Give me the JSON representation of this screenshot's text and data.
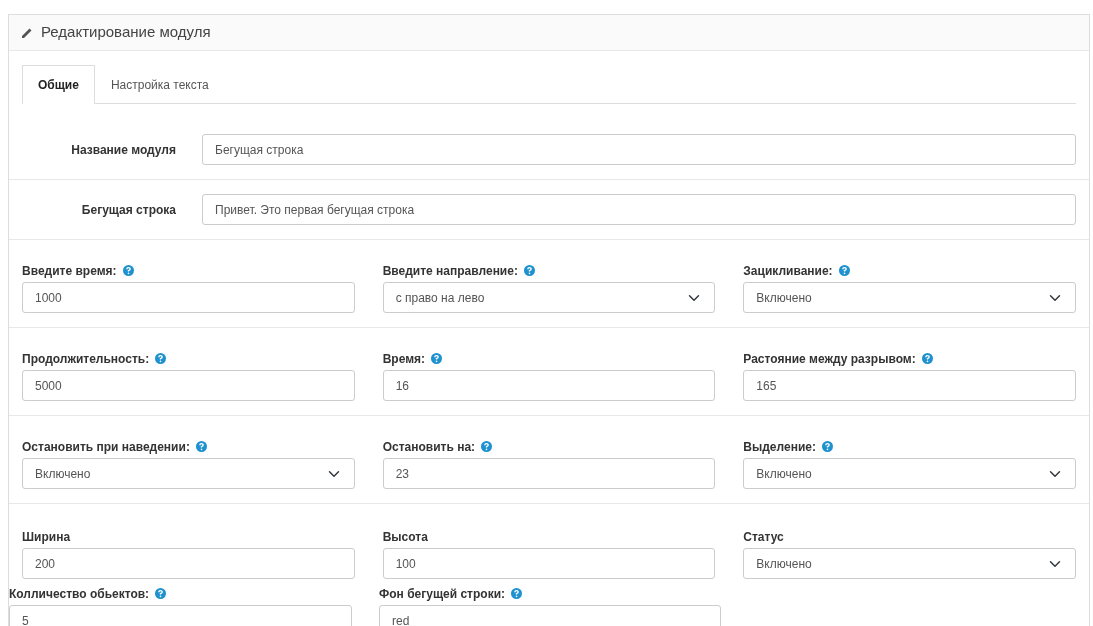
{
  "header": {
    "title": "Редактирование модуля"
  },
  "tabs": [
    {
      "label": "Общие",
      "selected": true
    },
    {
      "label": "Настройка текста",
      "selected": false
    }
  ],
  "top_fields": [
    {
      "label": "Название модуля",
      "value": "Бегущая строка"
    },
    {
      "label": "Бегущая строка",
      "value": "Привет. Это первая бегущая строка"
    }
  ],
  "field_rows": [
    [
      {
        "label": "Введите время:",
        "help": true,
        "kind": "input",
        "value": "1000"
      },
      {
        "label": "Введите направление:",
        "help": true,
        "kind": "select",
        "value": "с право на лево"
      },
      {
        "label": "Зацикливание:",
        "help": true,
        "kind": "select",
        "value": "Включено"
      }
    ],
    [
      {
        "label": "Продолжительность:",
        "help": true,
        "kind": "input",
        "value": "5000"
      },
      {
        "label": "Время:",
        "help": true,
        "kind": "input",
        "value": "16"
      },
      {
        "label": "Растояние между разрывом:",
        "help": true,
        "kind": "input",
        "value": "165"
      }
    ],
    [
      {
        "label": "Остановить при наведении:",
        "help": true,
        "kind": "select",
        "value": "Включено"
      },
      {
        "label": "Остановить на:",
        "help": true,
        "kind": "input",
        "value": "23"
      },
      {
        "label": "Выделение:",
        "help": true,
        "kind": "select",
        "value": "Включено"
      }
    ],
    [
      {
        "label": "Ширина",
        "help": false,
        "kind": "input",
        "value": "200"
      },
      {
        "label": "Высота",
        "help": false,
        "kind": "input",
        "value": "100"
      },
      {
        "label": "Статус",
        "help": false,
        "kind": "select",
        "value": "Включено"
      }
    ]
  ],
  "extra_fields": [
    {
      "label": "Колличество обьектов:",
      "help": true,
      "kind": "input",
      "value": "5"
    },
    {
      "label": "Фон бегущей строки:",
      "help": true,
      "kind": "input",
      "value": "red"
    }
  ]
}
